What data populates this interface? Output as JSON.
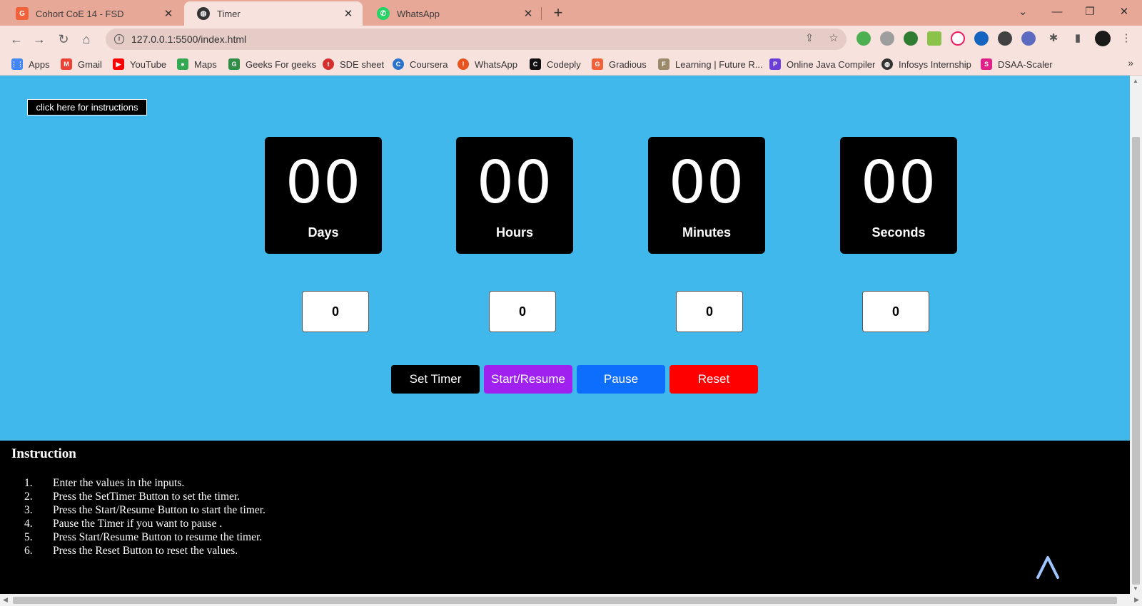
{
  "tabs": [
    {
      "title": "Cohort CoE 14 - FSD",
      "icon": "gradious-icon",
      "active": false
    },
    {
      "title": "Timer",
      "icon": "globe-icon",
      "active": true
    },
    {
      "title": "WhatsApp",
      "icon": "whatsapp-icon",
      "active": false
    }
  ],
  "tab_close_glyph": "✕",
  "newtab_glyph": "+",
  "address": {
    "url": "127.0.0.1:5500/index.html"
  },
  "bookmarks": [
    {
      "label": "Apps",
      "icon": "apps-grid-icon",
      "color": "#4285f4"
    },
    {
      "label": "Gmail",
      "icon": "gmail-icon",
      "color": "#ea4335"
    },
    {
      "label": "YouTube",
      "icon": "youtube-icon",
      "color": "#ff0000"
    },
    {
      "label": "Maps",
      "icon": "maps-pin-icon",
      "color": "#34a853"
    },
    {
      "label": "Geeks For geeks",
      "icon": "gfg-icon",
      "color": "#2f8d46"
    },
    {
      "label": "SDE sheet",
      "icon": "tuf-icon",
      "color": "#d62d2d"
    },
    {
      "label": "Coursera",
      "icon": "coursera-icon",
      "color": "#2a73cc"
    },
    {
      "label": "WhatsApp",
      "icon": "alert-icon",
      "color": "#e8541e"
    },
    {
      "label": "Codeply",
      "icon": "codeply-icon",
      "color": "#111111"
    },
    {
      "label": "Gradious",
      "icon": "gradious-icon",
      "color": "#f2623a"
    },
    {
      "label": "Learning | Future R...",
      "icon": "future-icon",
      "color": "#9a8a6a"
    },
    {
      "label": "Online Java Compiler",
      "icon": "compiler-icon",
      "color": "#6b3fd6"
    },
    {
      "label": "Infosys Internship",
      "icon": "globe-icon",
      "color": "#333333"
    },
    {
      "label": "DSAA-Scaler",
      "icon": "scaler-icon",
      "color": "#e0218a"
    }
  ],
  "instructions_button": "click here for instructions",
  "timer": [
    {
      "value": "00",
      "label": "Days"
    },
    {
      "value": "00",
      "label": "Hours"
    },
    {
      "value": "00",
      "label": "Minutes"
    },
    {
      "value": "00",
      "label": "Seconds"
    }
  ],
  "inputs": [
    "0",
    "0",
    "0",
    "0"
  ],
  "actions": [
    {
      "label": "Set Timer",
      "color": "#000000"
    },
    {
      "label": "Start/Resume",
      "color": "#a020f0"
    },
    {
      "label": "Pause",
      "color": "#0d6efd"
    },
    {
      "label": "Reset",
      "color": "#ff0000"
    }
  ],
  "instructions": {
    "title": "Instruction",
    "items": [
      "Enter the values in the inputs.",
      "Press the SetTimer Button to set the timer.",
      "Press the Start/Resume Button to start the timer.",
      "Pause the Timer if you want to pause .",
      "Press Start/Resume Button to resume the timer.",
      "Press the Reset Button to reset the values."
    ]
  },
  "colors": {
    "page_bg": "#41b8ec",
    "box_bg": "#000000",
    "instructions_bg": "#000000",
    "tabstrip": "#e8a898"
  }
}
